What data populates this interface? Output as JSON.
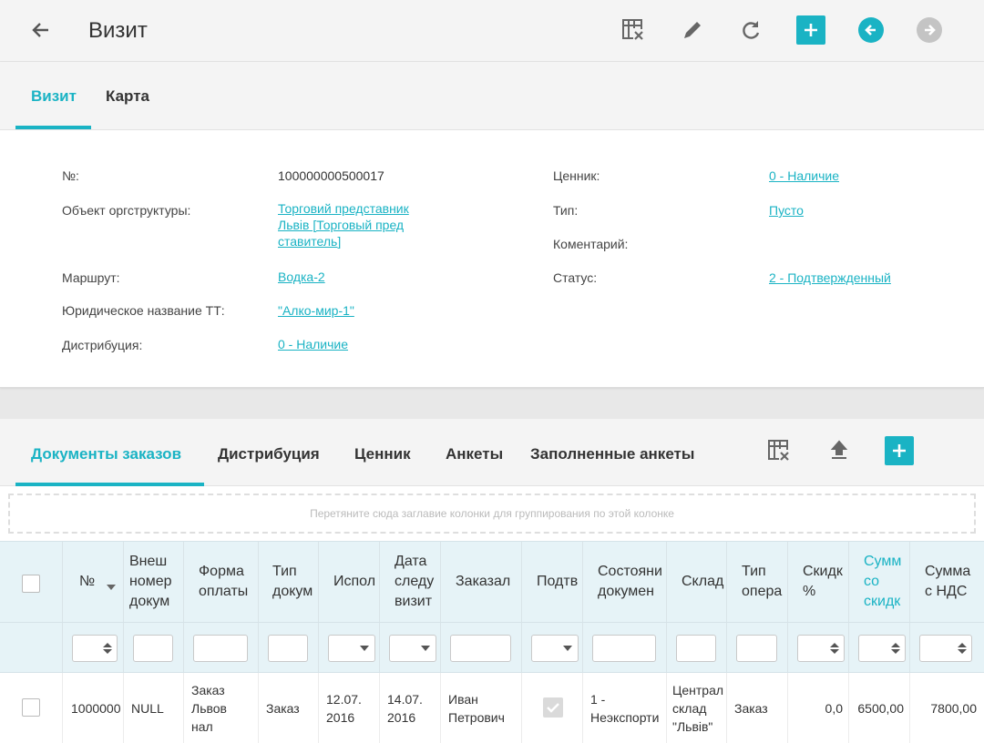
{
  "header": {
    "title": "Визит"
  },
  "tabs": [
    {
      "label": "Визит",
      "active": true
    },
    {
      "label": "Карта",
      "active": false
    }
  ],
  "details": {
    "number_label": "№:",
    "number_value": "100000000500017",
    "org_label": "Объект оргструктуры:",
    "org_value": "Торговий представник\nЛьвів [Торговый пред\nставитель]",
    "route_label": "Маршрут:",
    "route_value": "Водка-2",
    "legal_label": "Юридическое название ТТ:",
    "legal_value": "\"Алко-мир-1\"",
    "distrib_label": "Дистрибуция:",
    "distrib_value": "0 - Наличие",
    "price_label": "Ценник:",
    "price_value": "0 - Наличие",
    "type_label": "Тип:",
    "type_value": "Пусто",
    "comment_label": "Коментарий:",
    "status_label": "Статус:",
    "status_value": "2 - Подтвержденный"
  },
  "subtabs": [
    {
      "label": "Документы заказов",
      "active": true
    },
    {
      "label": "Дистрибуция",
      "active": false
    },
    {
      "label": "Ценник",
      "active": false
    },
    {
      "label": "Анкеты",
      "active": false
    },
    {
      "label": "Заполненные анкеты",
      "active": false
    }
  ],
  "grid": {
    "group_hint": "Перетяните сюда заглавие колонки для группирования по этой колонке",
    "columns": [
      "№",
      "Внеш\nномер\nдокум",
      "Форма\nоплаты",
      "Тип\nдокум",
      "Испол",
      "Дата\nследу\nвизит",
      "Заказал",
      "Подтв",
      "Состояни\nдокумен",
      "Склад",
      "Тип\nопера",
      "Скидк\n%",
      "Сумм\nсо\nскидк",
      "Сумма\nс НДС"
    ],
    "row": {
      "number": "1000000",
      "external": "NULL",
      "payment": "Заказ\nЛьвов\nнал",
      "doc_type": "Заказ",
      "executed": "12.07.\n2016",
      "next_visit": "14.07.\n2016",
      "ordered_by": "Иван\nПетрович",
      "state": "1 -\nНеэкспорти",
      "warehouse": "Централ\nсклад\n\"Львів\"",
      "op_type": "Заказ",
      "discount": "0,0",
      "sum_discount": "6500,00",
      "sum_vat": "7800,00"
    }
  },
  "colors": {
    "accent": "#1ab3c4",
    "header_bg": "#e6f3f7"
  },
  "icons": [
    "back-arrow-icon",
    "clear-filter-icon",
    "pencil-icon",
    "refresh-icon",
    "plus-icon",
    "prev-circle-icon",
    "next-circle-icon",
    "export-icon",
    "sort-desc-icon",
    "checkmark-icon"
  ]
}
